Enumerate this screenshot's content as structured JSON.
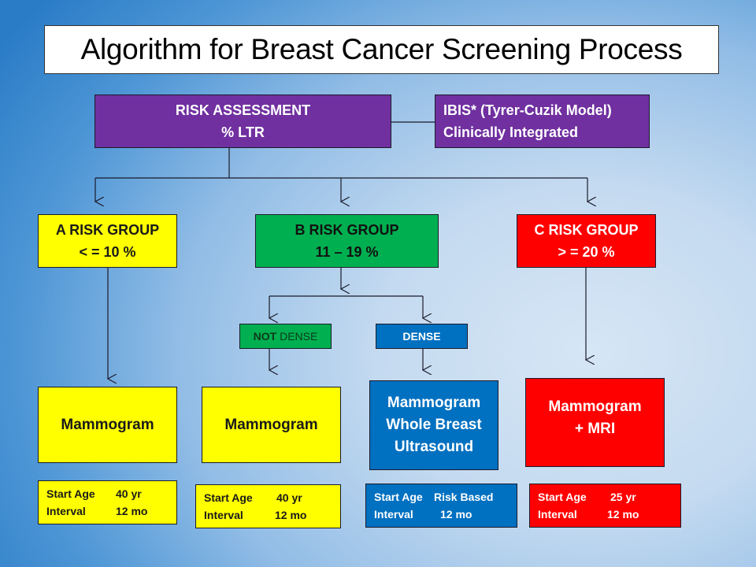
{
  "title": "Algorithm for Breast Cancer Screening Process",
  "colors": {
    "purple": "#7030a0",
    "yellow": "#ffff00",
    "green": "#00b050",
    "red": "#ff0000",
    "blue": "#0070c0",
    "background_light": "#d6e6f5",
    "background_dark": "#2a7cc7"
  },
  "risk_assessment": {
    "line1": "RISK ASSESSMENT",
    "line2": "% LTR"
  },
  "ibis": {
    "line1": "IBIS* (Tyrer-Cuzik Model)",
    "line2": "Clinically Integrated"
  },
  "groups": [
    {
      "id": "a",
      "line1": "A RISK GROUP",
      "line2": "< = 10 %",
      "color": "yellow"
    },
    {
      "id": "b",
      "line1": "B RISK GROUP",
      "line2": "11 – 19 %",
      "color": "green"
    },
    {
      "id": "c",
      "line1": "C RISK GROUP",
      "line2": "> = 20 %",
      "color": "red"
    }
  ],
  "density": {
    "not_dense": {
      "bold": "NOT",
      "rest": " DENSE"
    },
    "dense": "DENSE"
  },
  "screenings": [
    {
      "id": "a",
      "lines": [
        "Mammogram"
      ],
      "start_age_label": "Start Age",
      "start_age_value": "40 yr",
      "interval_label": "Interval",
      "interval_value": "12 mo"
    },
    {
      "id": "b-not-dense",
      "lines": [
        "Mammogram"
      ],
      "start_age_label": "Start Age",
      "start_age_value": "40 yr",
      "interval_label": "Interval",
      "interval_value": "12 mo"
    },
    {
      "id": "b-dense",
      "lines": [
        "Mammogram",
        "Whole Breast",
        "Ultrasound"
      ],
      "start_age_label": "Start Age",
      "start_age_value": "Risk Based",
      "interval_label": "Interval",
      "interval_value": "12 mo"
    },
    {
      "id": "c",
      "lines": [
        "Mammogram",
        "+ MRI"
      ],
      "start_age_label": "Start Age",
      "start_age_value": "25 yr",
      "interval_label": "Interval",
      "interval_value": "12 mo"
    }
  ]
}
